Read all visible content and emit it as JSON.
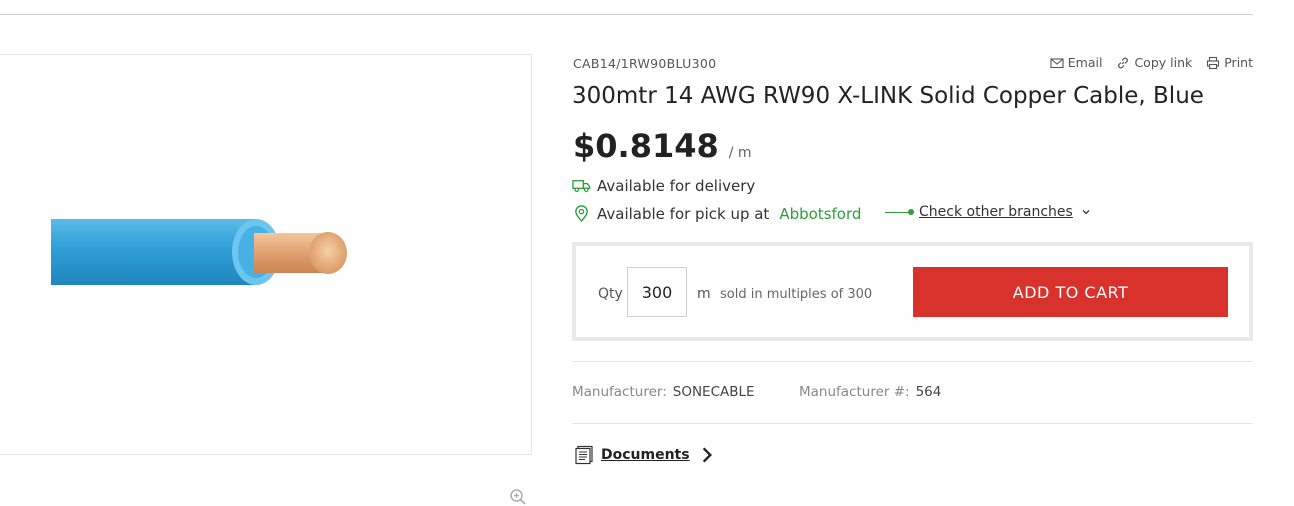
{
  "product": {
    "sku": "CAB14/1RW90BLU300",
    "title": "300mtr 14 AWG RW90 X-LINK Solid Copper Cable, Blue",
    "price": "$0.8148",
    "price_unit": "/ m"
  },
  "share": {
    "email": "Email",
    "copy_link": "Copy link",
    "print": "Print"
  },
  "availability": {
    "delivery": "Available for delivery",
    "pickup": "Available for pick up at",
    "branch": "Abbotsford",
    "check_branches": "Check other branches"
  },
  "cart": {
    "qty_label": "Qty",
    "qty_value": "300",
    "qty_unit": "m",
    "multiples": "sold in multiples of 300",
    "add_to_cart": "ADD TO CART"
  },
  "meta": {
    "manufacturer_label": "Manufacturer:",
    "manufacturer_value": "SONECABLE",
    "manufacturer_num_label": "Manufacturer #:",
    "manufacturer_num_value": "564"
  },
  "documents": {
    "label": "Documents"
  },
  "colors": {
    "accent_red": "#d9312b",
    "available_green": "#2e9d3a",
    "cable_blue": "#3aa7dc",
    "copper": "#e0a070"
  },
  "icons": [
    "truck-icon",
    "location-pin-icon",
    "mail-icon",
    "link-icon",
    "printer-icon",
    "zoom-icon",
    "chevron-down-icon",
    "documents-icon",
    "chevron-right-icon"
  ]
}
